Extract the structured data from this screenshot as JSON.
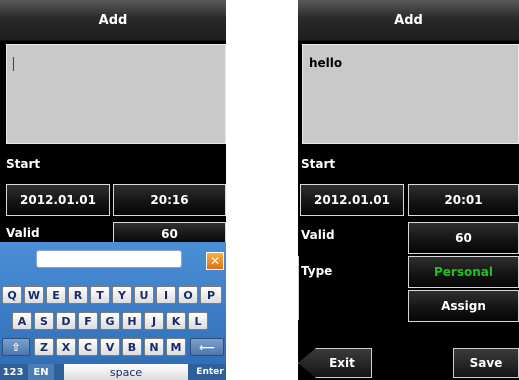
{
  "left": {
    "title": "Add",
    "text_value": "",
    "start_label": "Start",
    "date": "2012.01.01",
    "time": "20:16",
    "valid_label": "Valid",
    "valid_value": "60",
    "keyboard": {
      "close_glyph": "✕",
      "row1": [
        "Q",
        "W",
        "E",
        "R",
        "T",
        "Y",
        "U",
        "I",
        "O",
        "P"
      ],
      "row2": [
        "A",
        "S",
        "D",
        "F",
        "G",
        "H",
        "J",
        "K",
        "L"
      ],
      "row3": [
        "Z",
        "X",
        "C",
        "V",
        "B",
        "N",
        "M"
      ],
      "shift_glyph": "⇧",
      "backspace_glyph": "⟵",
      "mode_123": "123",
      "mode_en": "EN",
      "space": "space",
      "enter": "Enter"
    }
  },
  "right": {
    "title": "Add",
    "text_value": "hello",
    "start_label": "Start",
    "date": "2012.01.01",
    "time": "20:01",
    "valid_label": "Valid",
    "valid_value": "60",
    "type_label": "Type",
    "type_value": "Personal",
    "assign_label": "Assign",
    "exit_label": "Exit",
    "save_label": "Save"
  },
  "colors": {
    "accent_green": "#20c020",
    "keyboard_blue": "#2d6bb4"
  }
}
